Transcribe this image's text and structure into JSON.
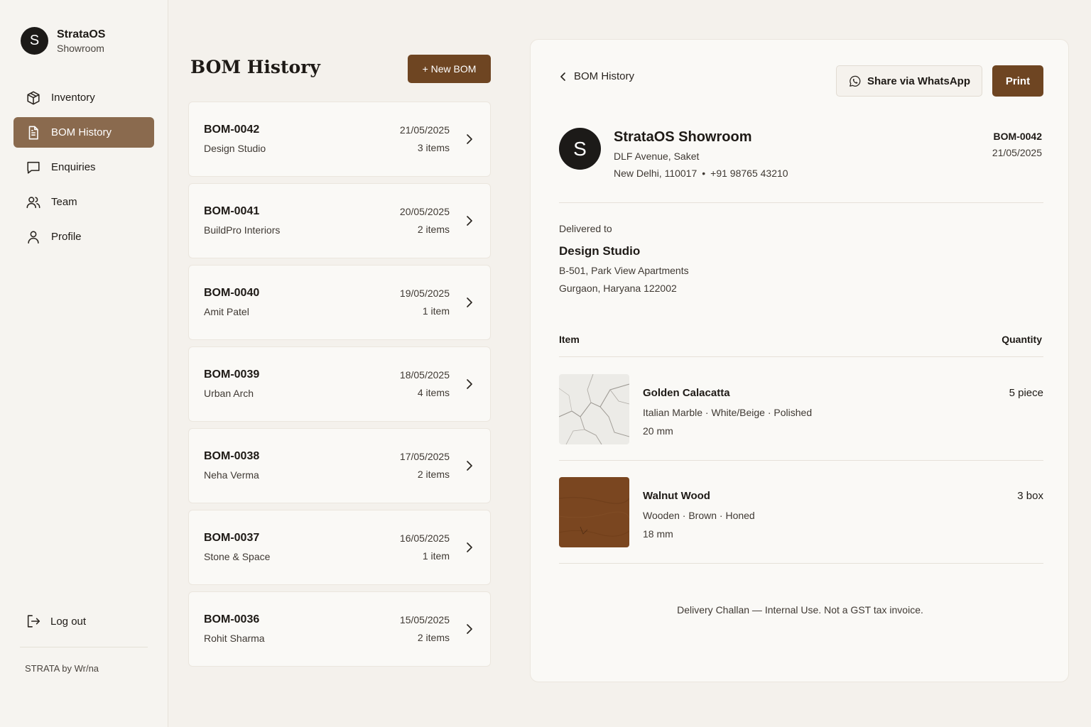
{
  "sidebar": {
    "brand_initial": "S",
    "brand_name": "StrataOS",
    "brand_sub": "Showroom",
    "items": [
      {
        "label": "Inventory",
        "icon": "box-icon",
        "active": false
      },
      {
        "label": "BOM History",
        "icon": "document-icon",
        "active": true
      },
      {
        "label": "Enquiries",
        "icon": "chat-icon",
        "active": false
      },
      {
        "label": "Team",
        "icon": "users-icon",
        "active": false
      },
      {
        "label": "Profile",
        "icon": "user-icon",
        "active": false
      }
    ],
    "logout_label": "Log out",
    "footer": "STRATA by Wr/na"
  },
  "list": {
    "title": "BOM History",
    "new_button": "+ New BOM",
    "boms": [
      {
        "id": "BOM-0042",
        "client": "Design Studio",
        "date": "21/05/2025",
        "count": "3 items"
      },
      {
        "id": "BOM-0041",
        "client": "BuildPro Interiors",
        "date": "20/05/2025",
        "count": "2 items"
      },
      {
        "id": "BOM-0040",
        "client": "Amit Patel",
        "date": "19/05/2025",
        "count": "1 item"
      },
      {
        "id": "BOM-0039",
        "client": "Urban Arch",
        "date": "18/05/2025",
        "count": "4 items"
      },
      {
        "id": "BOM-0038",
        "client": "Neha Verma",
        "date": "17/05/2025",
        "count": "2 items"
      },
      {
        "id": "BOM-0037",
        "client": "Stone & Space",
        "date": "16/05/2025",
        "count": "1 item"
      },
      {
        "id": "BOM-0036",
        "client": "Rohit Sharma",
        "date": "15/05/2025",
        "count": "2 items"
      }
    ]
  },
  "detail": {
    "back_label": "BOM History",
    "share_label": "Share via WhatsApp",
    "print_label": "Print",
    "shop": {
      "initial": "S",
      "name": "StrataOS Showroom",
      "address_line1": "DLF Avenue, Saket",
      "address_city": "New Delhi, 110017",
      "separator": "•",
      "phone": "+91 98765 43210"
    },
    "doc_id": "BOM-0042",
    "doc_date": "21/05/2025",
    "delivered_label": "Delivered to",
    "delivered_name": "Design Studio",
    "delivered_addr1": "B-501, Park View Apartments",
    "delivered_addr2": "Gurgaon, Haryana 122002",
    "table_header_item": "Item",
    "table_header_qty": "Quantity",
    "items": [
      {
        "name": "Golden Calacatta",
        "spec": "Italian Marble · White/Beige · Polished",
        "thickness": "20 mm",
        "qty": "5 piece"
      },
      {
        "name": "Walnut Wood",
        "spec": "Wooden · Brown · Honed",
        "thickness": "18 mm",
        "qty": "3 box"
      }
    ],
    "footnote": "Delivery Challan — Internal Use. Not a GST tax invoice."
  },
  "colors": {
    "accent": "#6e4522",
    "active_nav": "#8a6a4e",
    "background": "#f4f1ec",
    "card": "#faf9f6"
  }
}
